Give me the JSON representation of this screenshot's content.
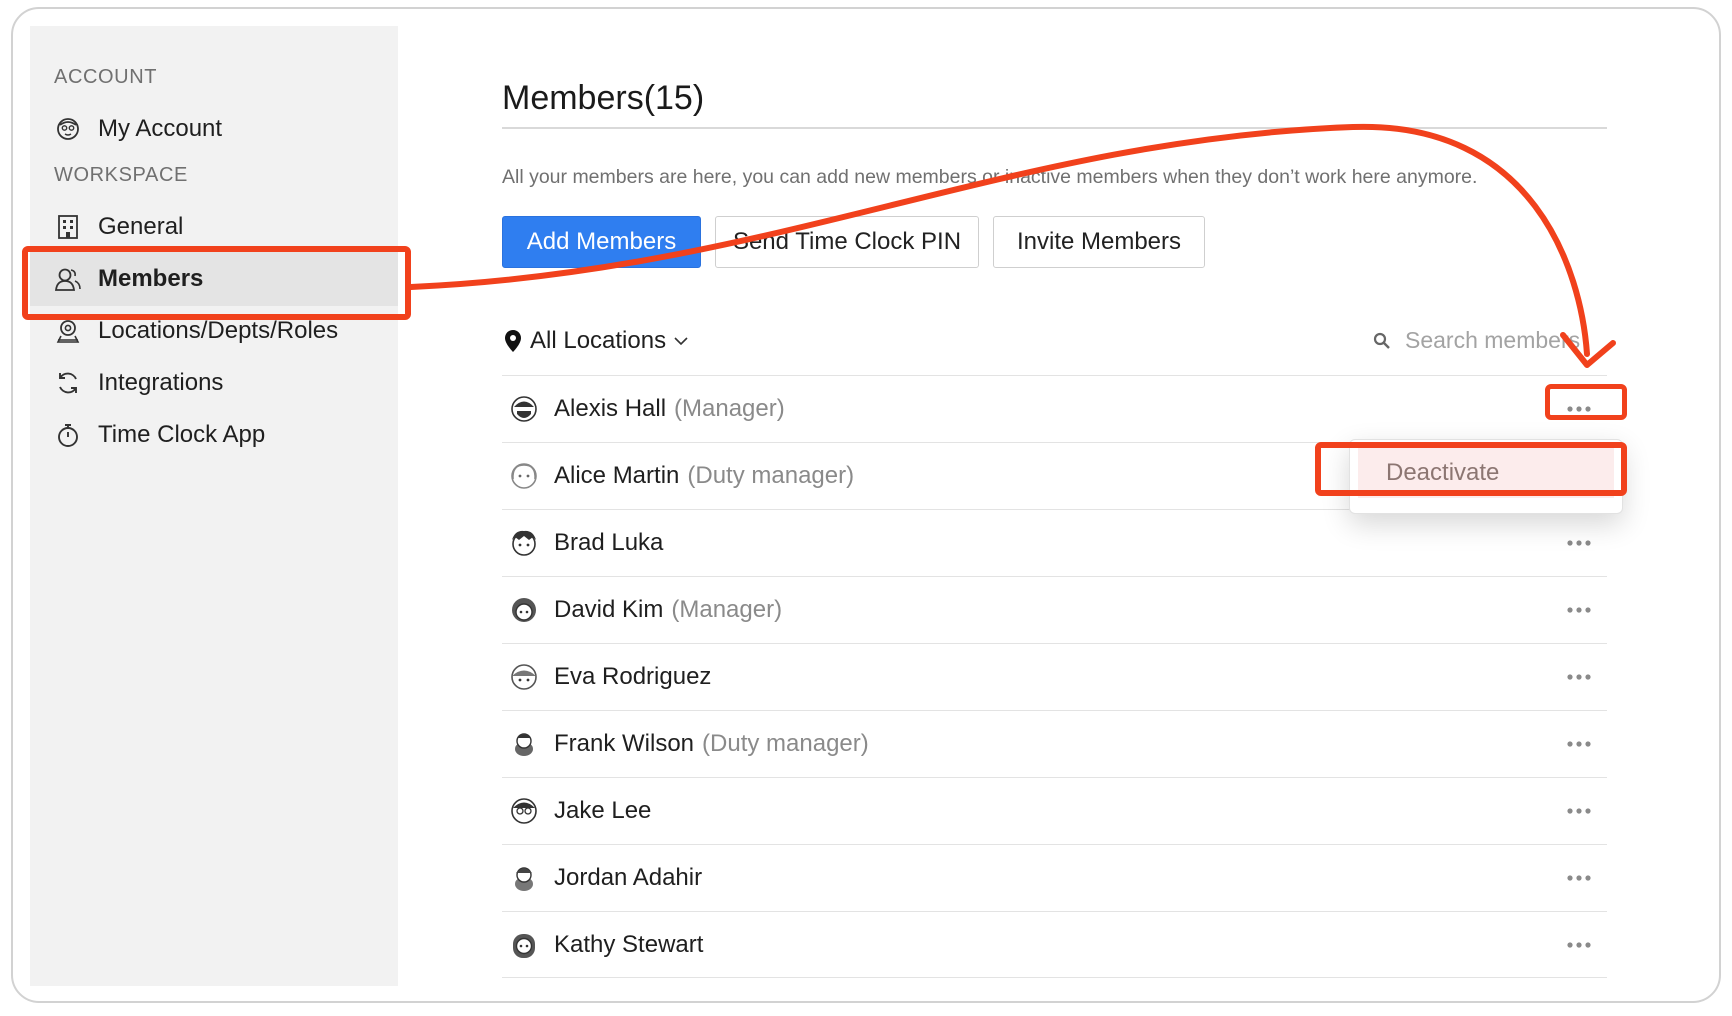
{
  "sidebar": {
    "account_label": "ACCOUNT",
    "workspace_label": "WORKSPACE",
    "items": [
      {
        "label": "My Account",
        "icon": "avatar-icon"
      },
      {
        "label": "General",
        "icon": "building-icon"
      },
      {
        "label": "Members",
        "icon": "members-icon",
        "active": true
      },
      {
        "label": "Locations/Depts/Roles",
        "icon": "location-icon"
      },
      {
        "label": "Integrations",
        "icon": "sync-icon"
      },
      {
        "label": "Time Clock App",
        "icon": "stopwatch-icon"
      }
    ]
  },
  "main": {
    "title": "Members(15)",
    "description": "All your members are here, you can add new members or inactive members when they don’t work here anymore.",
    "buttons": {
      "add": "Add Members",
      "send_pin": "Send Time Clock PIN",
      "invite": "Invite Members"
    },
    "location_filter": "All Locations",
    "search_placeholder": "Search members",
    "members": [
      {
        "name": "Alexis Hall",
        "role": "(Manager)"
      },
      {
        "name": "Alice Martin",
        "role": "(Duty manager)"
      },
      {
        "name": "Brad Luka",
        "role": ""
      },
      {
        "name": "David Kim",
        "role": "(Manager)"
      },
      {
        "name": "Eva Rodriguez",
        "role": ""
      },
      {
        "name": "Frank Wilson",
        "role": "(Duty manager)"
      },
      {
        "name": "Jake Lee",
        "role": ""
      },
      {
        "name": "Jordan Adahir",
        "role": ""
      },
      {
        "name": "Kathy Stewart",
        "role": ""
      }
    ],
    "more_menu": {
      "item": "Deactivate"
    }
  },
  "colors": {
    "primary": "#2f7ef0",
    "annotation": "#f1411c",
    "sidebar_bg": "#f2f2f2",
    "active_item_bg": "#e4e4e4",
    "menu_item_bg": "#fcecec"
  }
}
